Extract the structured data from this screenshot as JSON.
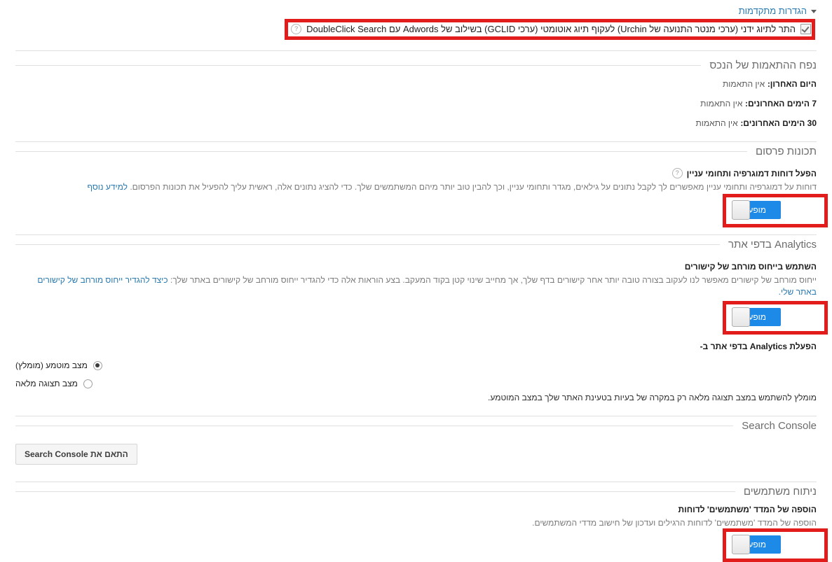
{
  "advanced": {
    "header_label": "הגדרות מתקדמות",
    "caret_icon": "chevron-down-icon",
    "checkbox_label": "התר לתיוג ידני (ערכי מנטר התנועה של Urchin) לעקוף תיוג אוטומטי (ערכי GCLID) בשילוב של Adwords עם DoubleClick Search",
    "checkbox_checked": true,
    "help_icon": "help-icon",
    "help_glyph": "?"
  },
  "hits_volume": {
    "section_title": "נפח ההתאמות של הנכס",
    "rows": [
      {
        "label": "היום האחרון:",
        "value": "אין התאמות"
      },
      {
        "label": "7 הימים האחרונים:",
        "value": "אין התאמות"
      },
      {
        "label": "30 הימים האחרונים:",
        "value": "אין התאמות"
      }
    ]
  },
  "advertising_features": {
    "section_title": "תכונות פרסום",
    "setting_label": "הפעל דוחות דמוגרפיה ותחומי עניין",
    "help_glyph": "?",
    "description": "דוחות על דמוגרפיה ותחומי עניין מאפשרים לך לקבל נתונים על גילאים, מגדר ותחומי עניין, וכך להבין טוב יותר מיהם המשתמשים שלך. כדי להציג נתונים אלה, ראשית עליך להפעיל את תכונות הפרסום.",
    "description_link": "למידע נוסף",
    "toggle_label": "מופעל",
    "toggle_on": true
  },
  "in_page_analytics": {
    "section_title": "Analytics בדפי אתר",
    "setting_label": "השתמש בייחוס מורחב של קישורים",
    "description": "ייחוס מורחב של קישורים מאפשר לנו לעקוב בצורה טובה יותר אחר קישורים בדף שלך, אך מחייב שינוי קטן בקוד המעקב. בצע הוראות אלה כדי להגדיר ייחוס מורחב של קישורים באתר שלך:",
    "description_link": "כיצד להגדיר ייחוס מורחב של קישורים באתר שלי.",
    "toggle_label": "מופעל",
    "toggle_on": true,
    "mode_label": "הפעלת Analytics בדפי אתר ב-",
    "options": [
      {
        "label": "מצב מוטמע (מומלץ)",
        "selected": true
      },
      {
        "label": "מצב תצוגה מלאה",
        "selected": false
      }
    ],
    "note": "מומלץ להשתמש במצב תצוגה מלאה רק במקרה של בעיות בטעינת האתר שלך במצב המוטמע."
  },
  "search_console": {
    "section_title": "Search Console",
    "button_label": "התאם את Search Console"
  },
  "user_analysis": {
    "section_title": "ניתוח משתמשים",
    "setting_label": "הוספה של המדד 'משתמשים' לדוחות",
    "description": "הוספה של המדד 'משתמשים' לדוחות הרגילים ועדכון של חישוב מדדי המשתמשים.",
    "toggle_label": "מופעל",
    "toggle_on": true
  },
  "colors": {
    "highlight_red": "#e21b1b",
    "toggle_blue": "#1e8ae8",
    "link_blue": "#2a7ab0",
    "rule_gray": "#e0e0e0"
  }
}
